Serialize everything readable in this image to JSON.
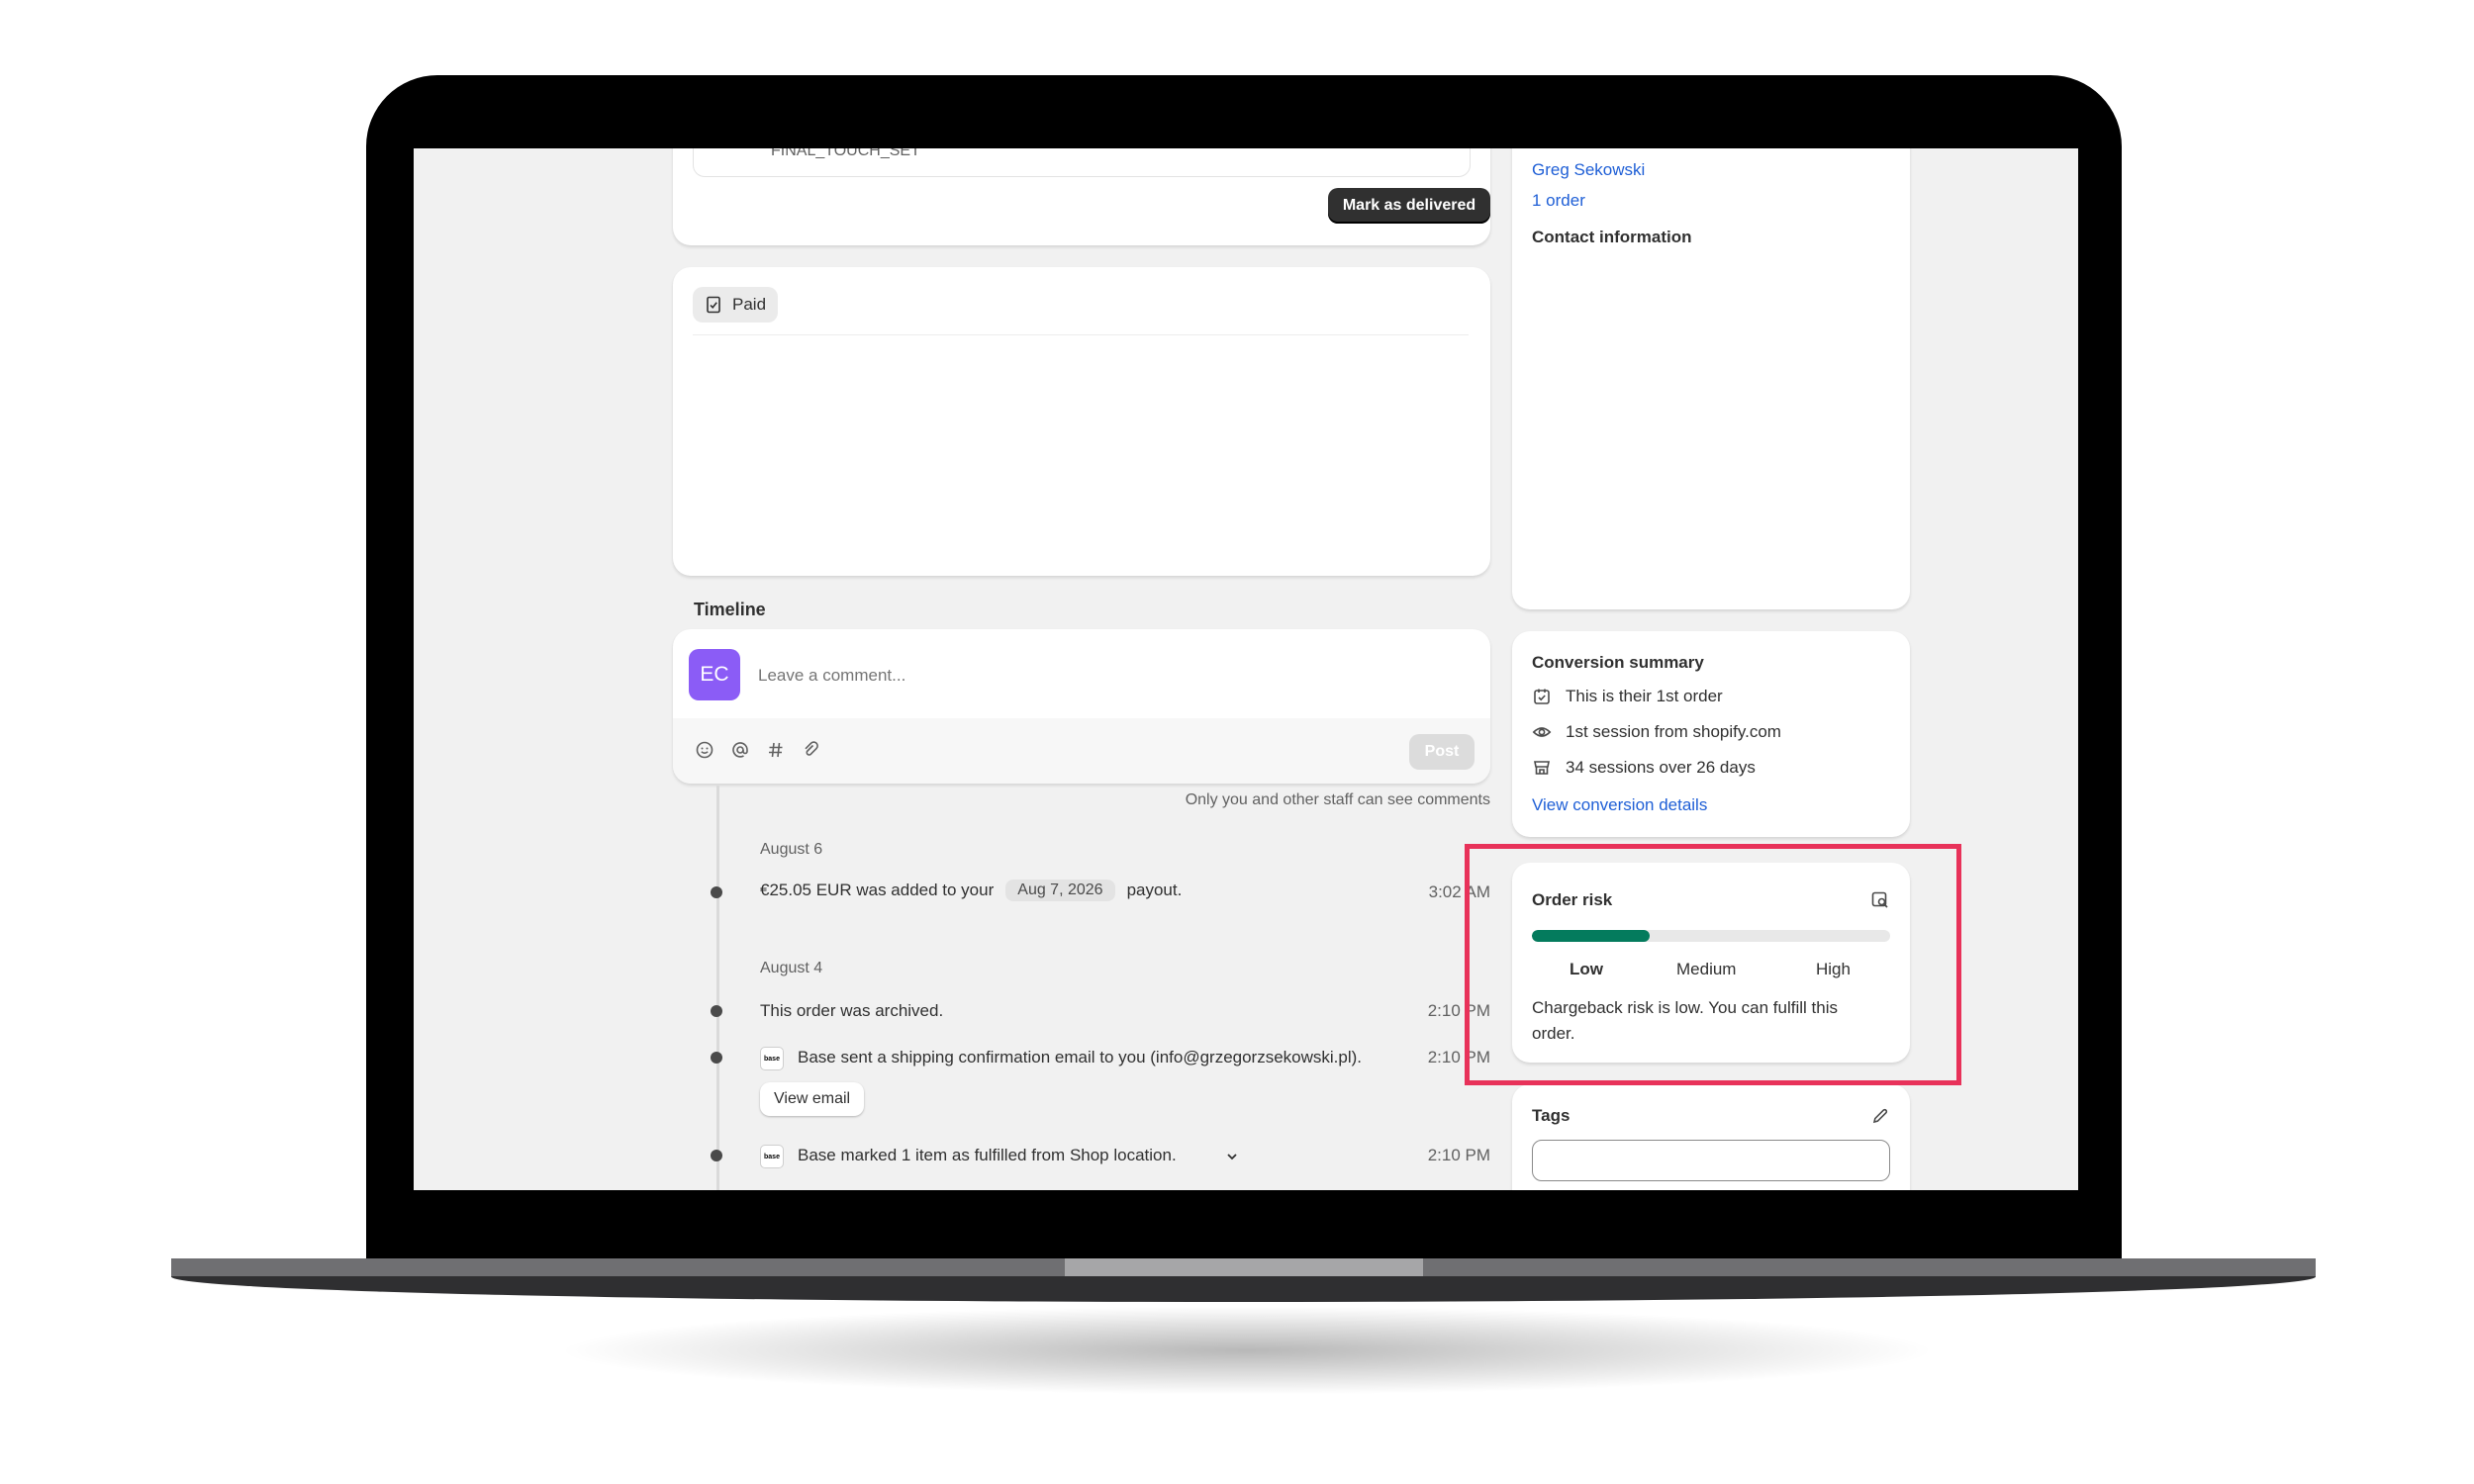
{
  "fulfillment": {
    "item_sku": "FINAL_TOUCH_SET",
    "mark_delivered_label": "Mark as delivered"
  },
  "payment": {
    "status_label": "Paid",
    "status_icon": "receipt-check-icon"
  },
  "timeline": {
    "title": "Timeline",
    "avatar_initials": "EC",
    "avatar_color": "#8b5cf6",
    "comment_placeholder": "Leave a comment...",
    "post_label": "Post",
    "staff_note": "Only you and other staff can see comments",
    "toolbar_icons": [
      "emoji-icon",
      "mention-icon",
      "hashtag-icon",
      "attachment-icon"
    ],
    "groups": [
      {
        "date": "August 6",
        "events": [
          {
            "text_before": "€25.05 EUR was added to your",
            "badge": "Aug 7, 2026",
            "text_after": "payout.",
            "time": "3:02 AM"
          }
        ]
      },
      {
        "date": "August 4",
        "events": [
          {
            "text": "This order was archived.",
            "time": "2:10 PM"
          },
          {
            "logo": "base",
            "text": "Base sent a shipping confirmation email to you (info@grzegorzsekowski.pl).",
            "time": "2:10 PM",
            "action": "View email"
          },
          {
            "logo": "base",
            "text": "Base marked 1 item as fulfilled from Shop location.",
            "time": "2:10 PM"
          }
        ]
      }
    ]
  },
  "customer": {
    "name": "Greg Sekowski",
    "orders": "1 order",
    "contact_heading": "Contact information"
  },
  "conversion": {
    "title": "Conversion summary",
    "items": [
      {
        "icon": "calendar-check-icon",
        "text": "This is their 1st order"
      },
      {
        "icon": "eye-icon",
        "text": "1st session from shopify.com"
      },
      {
        "icon": "store-icon",
        "text": "34 sessions over 26 days"
      }
    ],
    "link": "View conversion details"
  },
  "order_risk": {
    "title": "Order risk",
    "level_fraction": 0.33,
    "bar_color": "#047b5d",
    "levels": [
      "Low",
      "Medium",
      "High"
    ],
    "active_level": "Low",
    "message": "Chargeback risk is low. You can fulfill this order.",
    "highlight_color": "#e8325a"
  },
  "tags": {
    "title": "Tags",
    "input_value": ""
  }
}
